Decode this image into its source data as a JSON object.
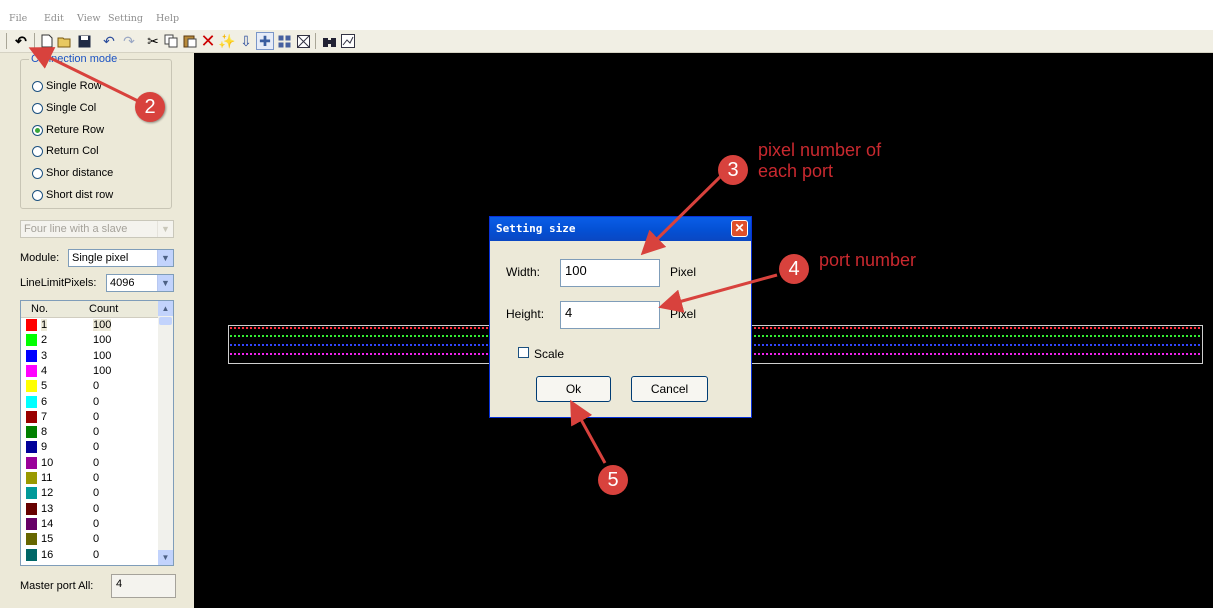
{
  "menu": [
    "File",
    "Edit",
    "View",
    "Setting",
    "Help"
  ],
  "toolbar_icons": [
    "undo-arrow-icon",
    "new-file-icon",
    "open-folder-icon",
    "save-icon",
    "undo-icon",
    "redo-icon",
    "cut-icon",
    "copy-icon",
    "paste-icon",
    "delete-icon",
    "wizard-icon",
    "move-down-icon",
    "crosshair-icon",
    "grid-icon",
    "frame-icon",
    "binoculars-icon",
    "chart-icon"
  ],
  "sidebar": {
    "connection_mode": {
      "title": "Connection mode",
      "options": [
        "Single Row",
        "Single Col",
        "Reture Row",
        "Return Col",
        "Shor distance",
        "Short dist row"
      ],
      "selected": "Reture Row"
    },
    "slave_combo": "Four line with a slave",
    "module_label": "Module:",
    "module_value": "Single pixel",
    "line_limit_label": "LineLimitPixels:",
    "line_limit_value": "4096",
    "ports_table": {
      "headers": [
        "No.",
        "Count"
      ],
      "rows": [
        {
          "no": "1",
          "count": "100",
          "color": "#ff0000"
        },
        {
          "no": "2",
          "count": "100",
          "color": "#00ff00"
        },
        {
          "no": "3",
          "count": "100",
          "color": "#0000ff"
        },
        {
          "no": "4",
          "count": "100",
          "color": "#ff00ff"
        },
        {
          "no": "5",
          "count": "0",
          "color": "#ffff00"
        },
        {
          "no": "6",
          "count": "0",
          "color": "#00ffff"
        },
        {
          "no": "7",
          "count": "0",
          "color": "#990000"
        },
        {
          "no": "8",
          "count": "0",
          "color": "#008000"
        },
        {
          "no": "9",
          "count": "0",
          "color": "#000099"
        },
        {
          "no": "10",
          "count": "0",
          "color": "#990099"
        },
        {
          "no": "11",
          "count": "0",
          "color": "#999900"
        },
        {
          "no": "12",
          "count": "0",
          "color": "#009999"
        },
        {
          "no": "13",
          "count": "0",
          "color": "#660000"
        },
        {
          "no": "14",
          "count": "0",
          "color": "#660066"
        },
        {
          "no": "15",
          "count": "0",
          "color": "#666600"
        },
        {
          "no": "16",
          "count": "0",
          "color": "#006666"
        }
      ]
    },
    "master_port_label": "Master port All:",
    "master_port_value": "4"
  },
  "canvas": {
    "led_colors": [
      "#ff3040",
      "#33ee33",
      "#3344ff",
      "#ee22ee"
    ]
  },
  "dialog": {
    "title": "Setting size",
    "width_label": "Width:",
    "width_value": "100",
    "width_unit": "Pixel",
    "height_label": "Height:",
    "height_value": "4",
    "height_unit": "Pixel",
    "scale_label": "Scale",
    "ok_label": "Ok",
    "cancel_label": "Cancel"
  },
  "annotations": {
    "step2": "2",
    "step3": "3",
    "step3_text_line1": "pixel number of",
    "step3_text_line2": "each port",
    "step4": "4",
    "step4_text": "port number",
    "step5": "5",
    "color": "#d8423d"
  }
}
